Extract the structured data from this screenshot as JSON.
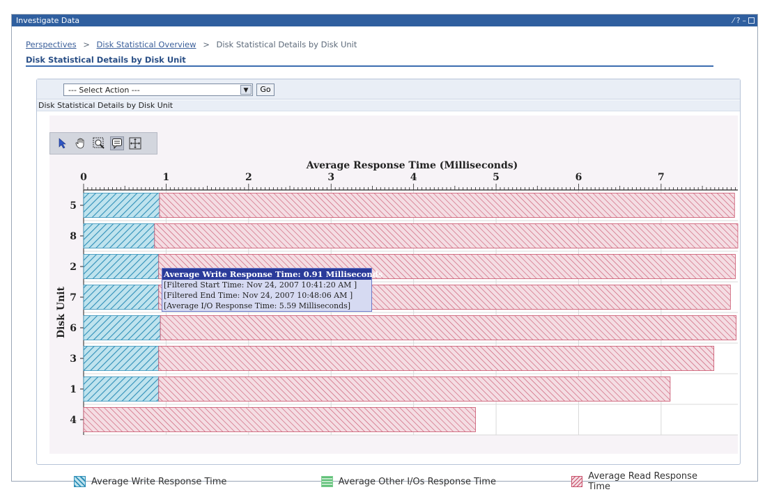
{
  "window": {
    "title": "Investigate Data",
    "icons": [
      "edit-icon",
      "help-icon",
      "minimize-icon",
      "maximize-icon"
    ]
  },
  "breadcrumb": {
    "items": [
      "Perspectives",
      "Disk Statistical Overview",
      "Disk Statistical Details by Disk Unit"
    ],
    "separator": ">"
  },
  "page": {
    "title": "Disk Statistical Details by Disk Unit"
  },
  "panel": {
    "select_action": "--- Select Action ---",
    "go_label": "Go",
    "header": "Disk Statistical Details by Disk Unit"
  },
  "tools": [
    "pointer-icon",
    "hand-icon",
    "zoom-icon",
    "tooltip-icon",
    "crosshair-icon"
  ],
  "tooltip": {
    "title": "Average Write Response Time: 0.91 Milliseconds",
    "lines": [
      "[Filtered Start Time: Nov 24, 2007 10:41:20 AM ]",
      "[Filtered End Time: Nov 24, 2007 10:48:06 AM ]",
      "[Average I/O Response Time: 5.59 Milliseconds]"
    ]
  },
  "chart_data": {
    "type": "bar",
    "orientation": "horizontal",
    "stacked": true,
    "xlabel": "Average Response Time (Milliseconds)",
    "ylabel": "Disk Unit",
    "xlim": [
      0,
      7.93
    ],
    "x_ticks": [
      0,
      1,
      2,
      3,
      4,
      5,
      6,
      7
    ],
    "categories": [
      "5",
      "8",
      "2",
      "7",
      "6",
      "3",
      "1",
      "4"
    ],
    "series": [
      {
        "name": "Average Write Response Time",
        "color": "#3aa0c8",
        "values": [
          0.92,
          0.86,
          0.91,
          0.91,
          0.93,
          0.91,
          0.91,
          0.0
        ]
      },
      {
        "name": "Average Other I/Os Response Time",
        "color": "#7fcf92",
        "values": [
          0,
          0,
          0,
          0,
          0,
          0,
          0,
          0
        ]
      },
      {
        "name": "Average Read Response Time",
        "color": "#c8506a",
        "values": [
          6.97,
          7.07,
          6.99,
          6.93,
          6.98,
          6.73,
          6.2,
          4.75
        ]
      }
    ],
    "grid": true,
    "legend": "bottom"
  }
}
